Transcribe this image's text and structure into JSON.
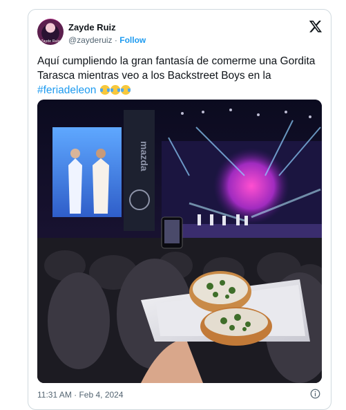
{
  "author": {
    "display_name": "Zayde Ruiz",
    "handle": "@zayderuiz",
    "separator": "·",
    "follow_label": "Follow",
    "avatar_caption": "Zayde Ruiz"
  },
  "tweet": {
    "text_before": "Aquí cumpliendo la gran fantasía de comerme una Gordita Tarasca mientras veo a los Backstreet Boys en la ",
    "hashtag": "#feriadeleon",
    "emojis": [
      "face-with-tears-of-joy",
      "face-with-tears-of-joy",
      "face-with-tears-of-joy"
    ]
  },
  "photo": {
    "description_icon": "concert-photo-with-gordita",
    "screen_brand": "mazda"
  },
  "meta": {
    "timestamp": "11:31 AM · Feb 4, 2024"
  },
  "colors": {
    "accent": "#1d9bf0",
    "text": "#0f1419",
    "muted": "#536471",
    "border": "#cfd9de"
  },
  "icons": {
    "close": "x-logo-icon",
    "info": "info-icon"
  }
}
